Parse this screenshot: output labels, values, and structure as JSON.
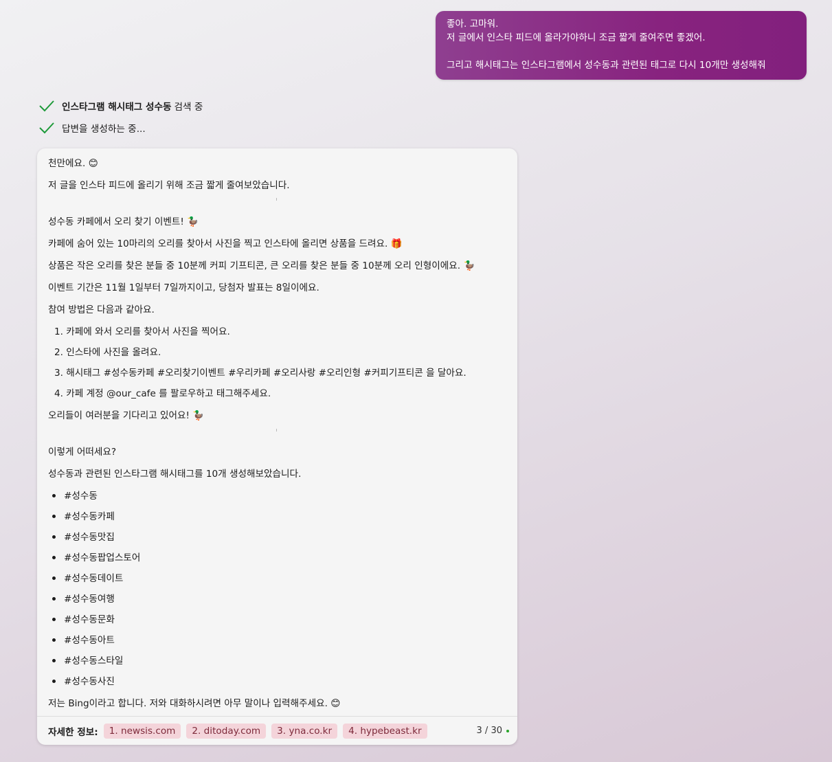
{
  "user_message": {
    "lines": [
      "좋아. 고마워.",
      "저 글에서 인스타 피드에 올라가야하니 조금 짧게 줄여주면 좋겠어.",
      "",
      "그리고 해시태그는 인스타그램에서 성수동과 관련된 태그로 다시 10개만 생성해줘"
    ]
  },
  "status": [
    {
      "bold": "인스타그램 해시태그 성수동",
      "text": "검색 중",
      "icon": "check-icon"
    },
    {
      "bold": "",
      "text": "답변을 생성하는 중...",
      "icon": "check-icon"
    }
  ],
  "response": {
    "p1": "천만에요. ",
    "p1_emoji": "😊",
    "p2": "저 글을 인스타 피드에 올리기 위해 조금 짧게 줄여보았습니다.",
    "post_title": "성수동 카페에서 오리 찾기 이벤트! ",
    "post_title_emoji": "🦆",
    "post_line1": "카페에 숨어 있는 10마리의 오리를 찾아서 사진을 찍고 인스타에 올리면 상품을 드려요. ",
    "post_line1_emoji": "🎁",
    "post_line2": "상품은 작은 오리를 찾은 분들 중 10분께 커피 기프티콘, 큰 오리를 찾은 분들 중 10분께 오리 인형이에요. ",
    "post_line2_emoji": "🦆",
    "post_line3": "이벤트 기간은 11월 1일부터 7일까지이고, 당첨자 발표는 8일이에요.",
    "post_line4": "참여 방법은 다음과 같아요.",
    "steps": [
      "1. 카페에 와서 오리를 찾아서 사진을 찍어요.",
      "2. 인스타에 사진을 올려요.",
      "3. 해시태그 #성수동카페 #오리찾기이벤트 #우리카페 #오리사랑 #오리인형 #커피기프티콘 을 달아요.",
      "4. 카페 계정 @our_cafe 를 팔로우하고 태그해주세요."
    ],
    "post_end": "오리들이 여러분을 기다리고 있어요! ",
    "post_end_emoji": "🦆",
    "q": "이렇게 어떠세요?",
    "hashtag_intro": "성수동과 관련된 인스타그램 해시태그를 10개 생성해보았습니다.",
    "hashtags": [
      "#성수동",
      "#성수동카페",
      "#성수동맛집",
      "#성수동팝업스토어",
      "#성수동데이트",
      "#성수동여행",
      "#성수동문화",
      "#성수동아트",
      "#성수동스타일",
      "#성수동사진"
    ],
    "closing": "저는 Bing이라고 합니다. 저와 대화하시려면 아무 말이나 입력해주세요. ",
    "closing_emoji": "😊"
  },
  "references": {
    "label": "자세한 정보:",
    "items": [
      "1. newsis.com",
      "2. ditoday.com",
      "3. yna.co.kr",
      "4. hypebeast.kr"
    ],
    "count": "3 / 30"
  },
  "colors": {
    "user_bubble": "#88237f",
    "check": "#1e9a3a",
    "chip_bg": "#f4d4da",
    "chip_text": "#7d2a3a"
  }
}
